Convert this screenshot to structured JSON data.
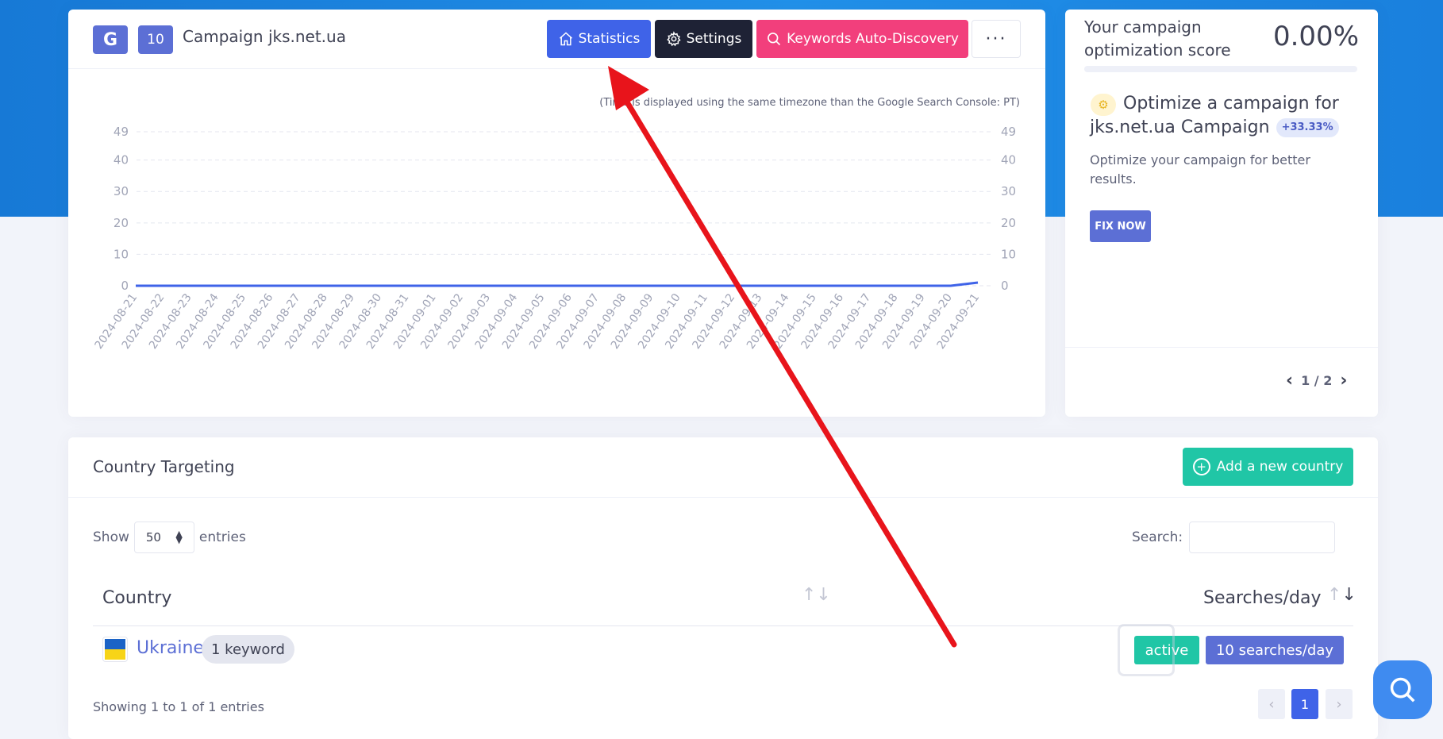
{
  "campaign": {
    "g_badge": "G",
    "keyword_count": "10",
    "title": "Campaign jks.net.ua"
  },
  "header_buttons": {
    "statistics": "Statistics",
    "settings": "Settings",
    "keywords": "Keywords Auto-Discovery",
    "more": "···"
  },
  "chart": {
    "note": "(Time is displayed using the same timezone than the Google Search Console: PT)"
  },
  "chart_data": {
    "type": "line",
    "x": [
      "2024-08-21",
      "2024-08-22",
      "2024-08-23",
      "2024-08-24",
      "2024-08-25",
      "2024-08-26",
      "2024-08-27",
      "2024-08-28",
      "2024-08-29",
      "2024-08-30",
      "2024-08-31",
      "2024-09-01",
      "2024-09-02",
      "2024-09-03",
      "2024-09-04",
      "2024-09-05",
      "2024-09-06",
      "2024-09-07",
      "2024-09-08",
      "2024-09-09",
      "2024-09-10",
      "2024-09-11",
      "2024-09-12",
      "2024-09-13",
      "2024-09-14",
      "2024-09-15",
      "2024-09-16",
      "2024-09-17",
      "2024-09-18",
      "2024-09-19",
      "2024-09-20",
      "2024-09-21"
    ],
    "series": [
      {
        "values": [
          0,
          0,
          0,
          0,
          0,
          0,
          0,
          0,
          0,
          0,
          0,
          0,
          0,
          0,
          0,
          0,
          0,
          0,
          0,
          0,
          0,
          0,
          0,
          0,
          0,
          0,
          0,
          0,
          0,
          0,
          0,
          1
        ],
        "color": "#3f63e8"
      }
    ],
    "y_ticks": [
      0,
      10,
      20,
      30,
      40,
      49
    ],
    "ylim": [
      0,
      49
    ],
    "grid": true,
    "dual_y_axis": true
  },
  "optimization": {
    "title": "Your campaign optimization score",
    "score": "0.00%",
    "progress": 0,
    "heading": "Optimize a campaign for jks.net.ua Campaign",
    "gain": "+33.33%",
    "description": "Optimize your campaign for better results.",
    "fix_button": "FIX NOW",
    "pager": "1 / 2"
  },
  "country_targeting": {
    "title": "Country Targeting",
    "add_button": "Add a new country",
    "show_label": "Show",
    "entries_value": "50",
    "entries_label": "entries",
    "search_label": "Search:",
    "columns": [
      "Country",
      "Searches/day"
    ],
    "rows": [
      {
        "country": "Ukraine",
        "keywords": "1 keyword",
        "status": "active",
        "searches": "10 searches/day"
      }
    ],
    "showing": "Showing 1 to 1 of 1 entries",
    "page": "1"
  },
  "colors": {
    "primary": "#3f63e8",
    "accent_pink": "#f23f7c",
    "teal": "#20c6a6",
    "indigo": "#5c6fd5",
    "annotation_arrow": "#e8141b"
  }
}
